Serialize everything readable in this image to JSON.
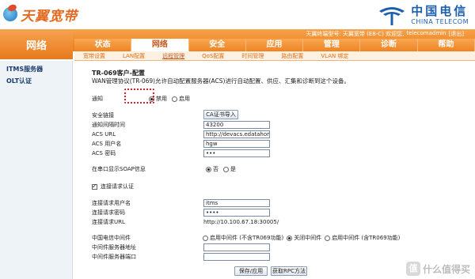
{
  "brand": {
    "name": "天翼宽带"
  },
  "telecom": {
    "cn": "中国电信",
    "en": "CHINA TELECOM"
  },
  "header": {
    "section_title": "网络",
    "device_info": "天翼终端型号: 天翼宽带 (E8-C) 欢迎您,",
    "user": "telecomadmin",
    "exit": "[退出]"
  },
  "main_nav": [
    "状态",
    "网络",
    "安全",
    "应用",
    "管理",
    "诊断",
    "帮助"
  ],
  "main_nav_active": "网络",
  "sub_nav": [
    "宽带设置",
    "LAN配置",
    "远程管理",
    "QoS配置",
    "时间管理",
    "路由配置",
    "VLAN 绑定"
  ],
  "sub_nav_active": "远程管理",
  "sidebar": {
    "items": [
      "ITMS服务器",
      "OLT认证"
    ]
  },
  "page": {
    "title": "TR-069客户-配置",
    "desc": "WAN管理协议(TR-069)允许自动配置服务器(ACS)进行自动配置、供应、汇集和诊断到这个设备。"
  },
  "form": {
    "notify_label": "通知",
    "notify_opt_disable": "禁用",
    "notify_opt_enable": "启用",
    "secure_link_label": "安全链接",
    "ca_import_button": "CA证书导入",
    "interval_label": "通知间隔时间",
    "interval_value": "43200",
    "acs_url_label": "ACS URL",
    "acs_url_value": "http://devacs.edatahome.c",
    "acs_user_label": "ACS 用户名",
    "acs_user_value": "hgw",
    "acs_pass_label": "ACS 密码",
    "acs_pass_value": "•••",
    "soap_label": "在串口显示SOAP信息",
    "soap_opt_no": "否",
    "soap_opt_yes": "是",
    "conn_auth_label": "连接请求认证",
    "conn_user_label": "连接请求用户名",
    "conn_user_value": "itms",
    "conn_pass_label": "连接请求密码",
    "conn_pass_value": "••••",
    "conn_url_label": "连接请求URL",
    "conn_url_value": "http://10.100.67.18:30005/",
    "middleware_label": "中国电信中间件",
    "mw_opt_enable": "启用中间件 (不含TR069功能)",
    "mw_opt_disable": "关闭中间件",
    "mw_opt_enable_full": "启用中间件 (含TR069功能)",
    "mw_addr_label": "中间件服务器地址",
    "mw_port_label": "中间件服务器端口",
    "save_button": "保存/应用",
    "rpc_button": "获取RPC方法"
  },
  "watermark": {
    "badge": "值",
    "text": "什么值得买"
  }
}
